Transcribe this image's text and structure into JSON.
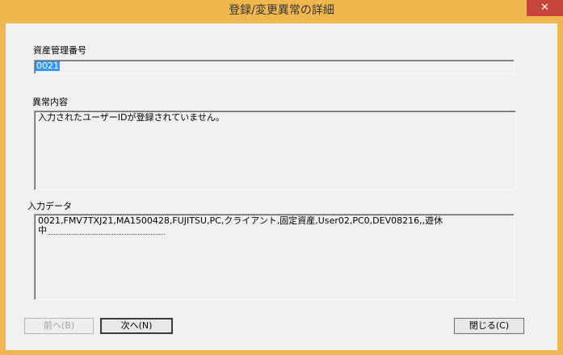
{
  "window": {
    "title": "登録/変更異常の詳細",
    "close_glyph": "✕"
  },
  "asset_number": {
    "label": "資産管理番号",
    "value": "0021"
  },
  "error_content": {
    "label": "異常内容",
    "value": "入力されたユーザーIDが登録されていません。"
  },
  "input_data": {
    "label": "入力データ",
    "value": "0021,FMV7TXJ21,MA1500428,FUJITSU,PC,クライアント,固定資産,User02,PC0,DEV08216,,遊休\n中"
  },
  "buttons": {
    "prev": "前へ(B)",
    "next": "次へ(N)",
    "close": "閉じる(C)"
  }
}
